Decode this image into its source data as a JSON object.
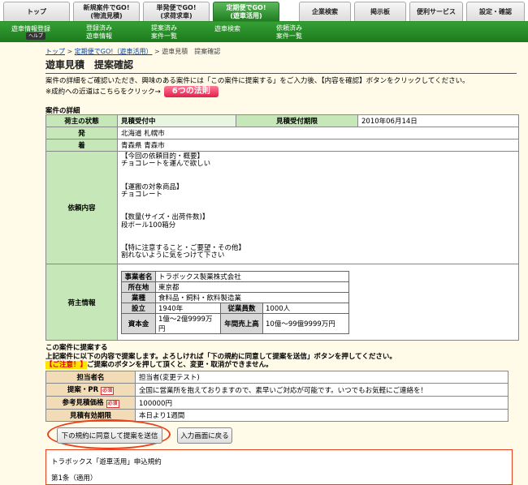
{
  "topnav": {
    "tabs": [
      {
        "label": "トップ",
        "active": false
      },
      {
        "label": "新規案件でGO!\n(物流見積)",
        "active": false
      },
      {
        "label": "単発便でGO!\n(求荷求車)",
        "active": false
      },
      {
        "label": "定期便でGO!\n(遊車活用)",
        "active": true
      },
      {
        "label": "企業検索",
        "active": false
      },
      {
        "label": "掲示板",
        "active": false
      },
      {
        "label": "便利サービス",
        "active": false
      },
      {
        "label": "設定・確認",
        "active": false
      }
    ]
  },
  "subnav": {
    "items": [
      {
        "label": "遊車情報登録"
      },
      {
        "label": "登録済み\n遊車情報"
      },
      {
        "label": "提案済み\n案件一覧"
      },
      {
        "label": "遊車検索"
      },
      {
        "label": "依頼済み\n案件一覧"
      }
    ],
    "help": "ヘルプ"
  },
  "breadcrumb": {
    "top": "トップ",
    "sep": ">",
    "parent": "定期便でGO!（遊車活用）",
    "current": "遊車見積　提案確認"
  },
  "page_title": "遊車見積　提案確認",
  "intro": {
    "line1": "案件の詳細をご確認いただき、興味のある案件には「この案件に提案する」をご入力後、【内容を確認】ボタンをクリックしてください。",
    "line2": "※成約への近道はこちらをクリック→",
    "rule_button": "6つの法則"
  },
  "detail": {
    "title": "案件の詳細",
    "status_label": "荷主の状態",
    "status_value": "見積受付中",
    "deadline_label": "見積受付期限",
    "deadline_value": "2010年06月14日",
    "from_label": "発",
    "from_value": "北海道 札幌市",
    "to_label": "着",
    "to_value": "青森県 青森市",
    "request_label": "依頼内容",
    "request_lines": [
      "【今回の依頼目的・概要】",
      "チョコレートを運んで欲しい",
      "",
      "",
      "【運搬の対象商品】",
      "チョコレート",
      "",
      "",
      "【数量(サイズ・出荷件数)】",
      "段ボール100箱分",
      "",
      "",
      "【特に注意すること・ご要望・その他】",
      "割れないように気をつけて下さい"
    ],
    "shipper_label": "荷主情報",
    "company": {
      "name_label": "事業者名",
      "name": "トラボックス製菓株式会社",
      "addr_label": "所在地",
      "addr": "東京都",
      "biz_label": "業種",
      "biz": "食料品・飼料・飲料製造業",
      "est_label": "設立",
      "est": "1940年",
      "emp_label": "従業員数",
      "emp": "1000人",
      "cap_label": "資本金",
      "cap": "1億〜2億9999万円",
      "sales_label": "年間売上高",
      "sales": "10億〜99億9999万円"
    }
  },
  "proposal": {
    "title": "この案件に提案する",
    "line1": "上記案件に以下の内容で提案します。よろしければ「下の規約に同意して提案を送信」ボタンを押してください。",
    "caution_tag": "【ご注意！】",
    "caution_text": "ご提案のボタンを押して頂くと、変更・取消ができません。",
    "required_badge": "必須",
    "rows": [
      {
        "label": "担当者名",
        "value": "担当者(変更テスト)",
        "required": false
      },
      {
        "label": "提案・PR",
        "value": "全国に営業所を抱えておりますので、素早いご対応が可能です。いつでもお気軽にご連絡を！",
        "required": true
      },
      {
        "label": "参考見積価格",
        "value": "100000円",
        "required": true
      },
      {
        "label": "見積有効期限",
        "value": "本日より1週間",
        "required": false
      }
    ]
  },
  "buttons": {
    "agree_send": "下の規約に同意して提案を送信",
    "back": "入力画面に戻る"
  },
  "terms": {
    "title": "トラボックス「遊車活用」申込規約",
    "first": "第1条（適用）"
  }
}
